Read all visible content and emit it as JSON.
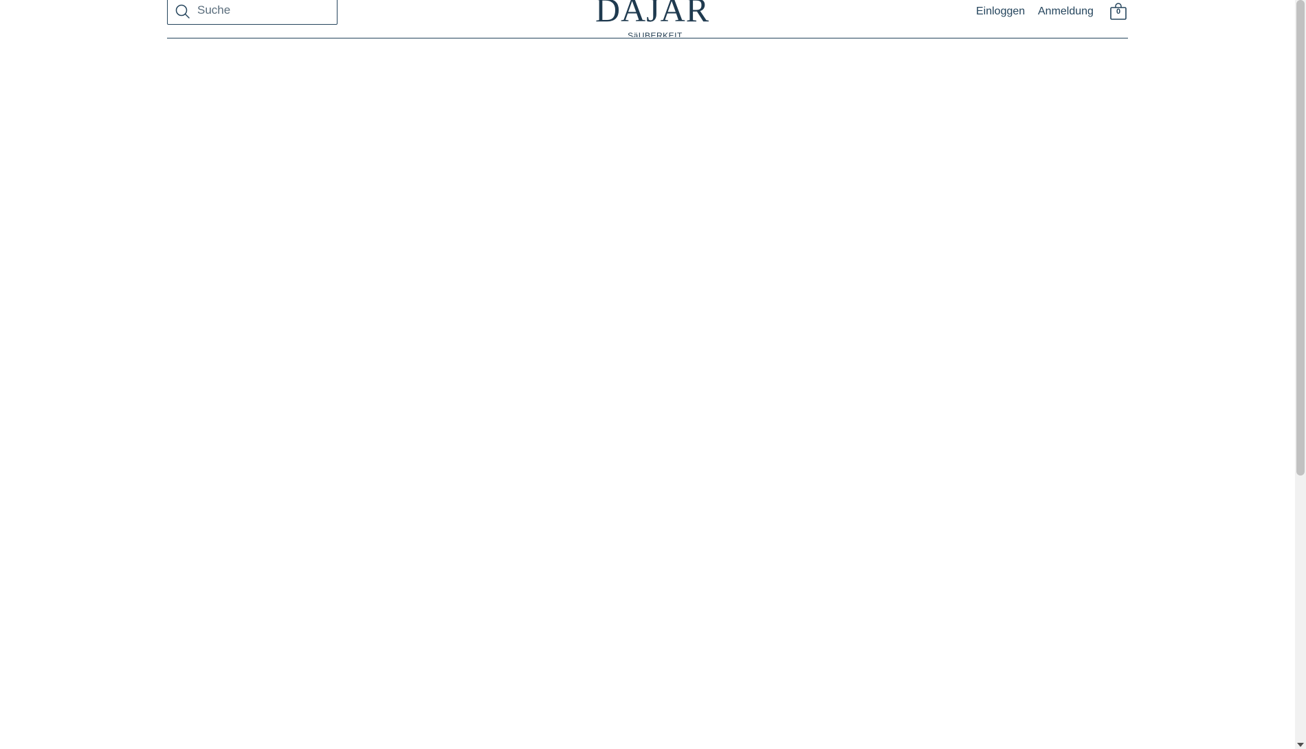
{
  "header": {
    "search": {
      "placeholder": "Suche",
      "value": "",
      "icon": "search-icon"
    },
    "logo": {
      "text": "DAJAR",
      "subtitle": "SäUBERKEIT"
    },
    "nav": {
      "login_label": "Einloggen",
      "register_label": "Anmeldung"
    },
    "cart": {
      "icon": "shopping-bag-icon",
      "count": "0"
    }
  },
  "colors": {
    "brand": "#1f3a4f",
    "border": "#24445c",
    "background": "#ffffff"
  }
}
